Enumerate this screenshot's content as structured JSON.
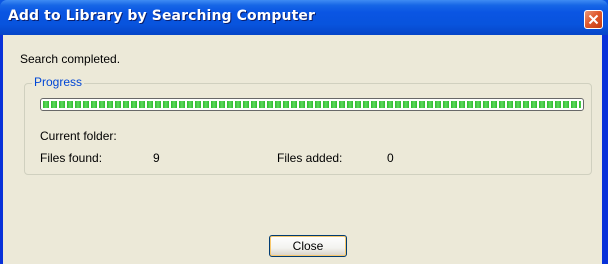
{
  "window": {
    "title": "Add to Library by Searching Computer"
  },
  "titlebar_buttons": {
    "close_icon": "close-icon"
  },
  "status": {
    "message": "Search completed."
  },
  "progress_group": {
    "label": "Progress",
    "progress_fraction": 1.0,
    "current_folder_label": "Current folder:",
    "current_folder_value": "",
    "files_found_label": "Files found:",
    "files_found_value": "9",
    "files_added_label": "Files added:",
    "files_added_value": "0"
  },
  "buttons": {
    "close_label": "Close"
  },
  "colors": {
    "titlebar": "#0a55e3",
    "client_background": "#ece9d8",
    "group_label": "#0046d5",
    "progress_fill": "#2dbb2d",
    "close_button": "#e05a2e"
  }
}
